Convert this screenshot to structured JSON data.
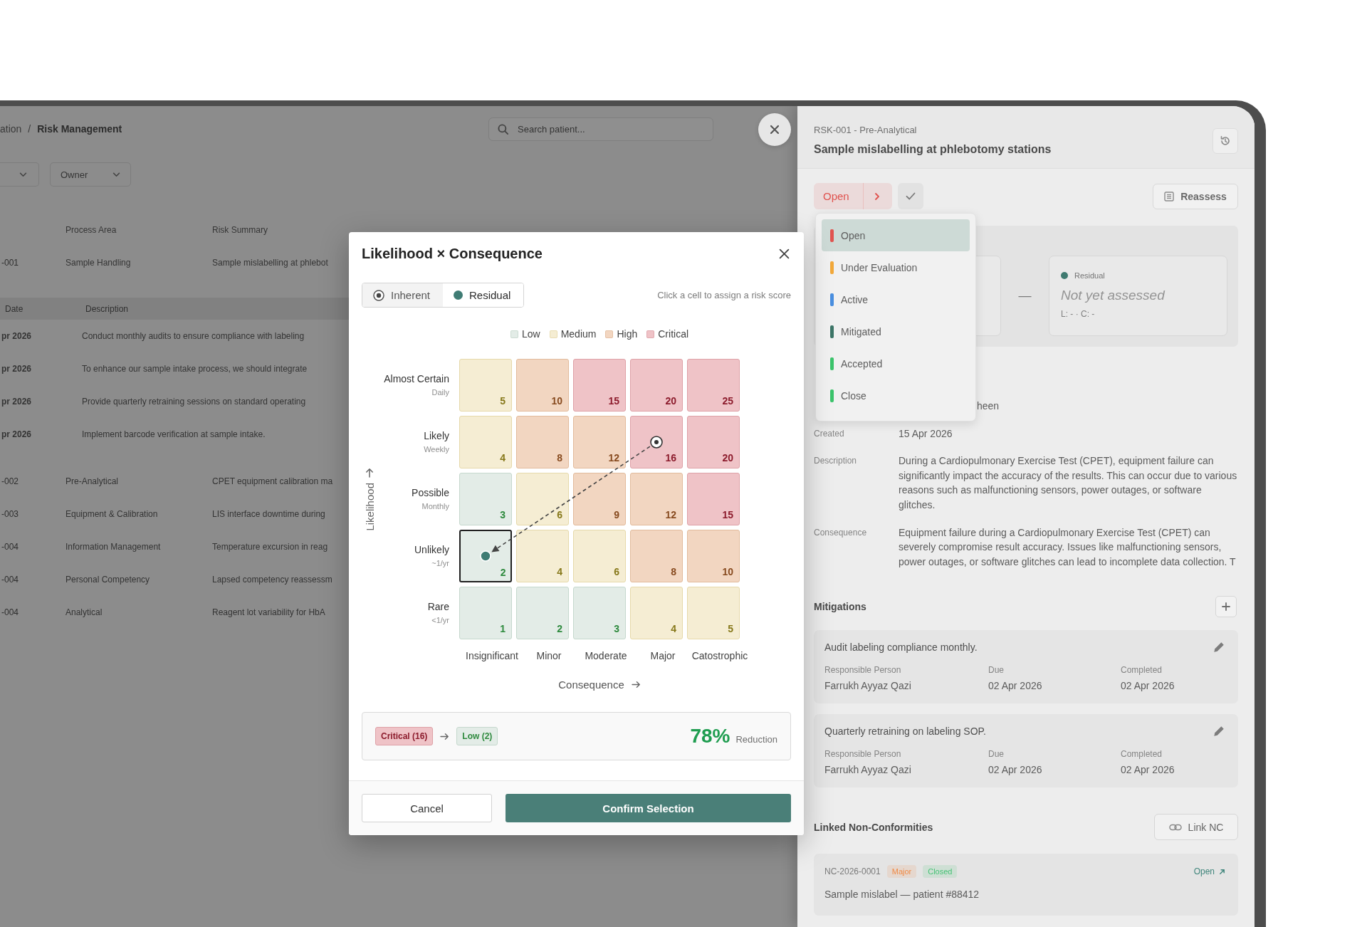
{
  "page": {
    "breadcrumb": {
      "parent": "ation",
      "separator": "/",
      "current": "Risk Management"
    },
    "search": {
      "placeholder": "Search patient..."
    },
    "filters": [
      {
        "kind": "dropdown"
      },
      {
        "kind": "dropdown",
        "label": "Owner"
      }
    ],
    "table": {
      "columns": [
        "Process Area",
        "Risk Summary"
      ],
      "rows": [
        {
          "id": "-001",
          "process_area": "Sample Handling",
          "summary": "Sample mislabelling at phlebot",
          "mitigations": {
            "columns": [
              "Date",
              "Description"
            ],
            "rows": [
              {
                "date": "pr 2026",
                "description": "Conduct monthly audits to ensure compliance with labeling"
              },
              {
                "date": "pr 2026",
                "description": "To enhance our sample intake process, we should integrate"
              },
              {
                "date": "pr 2026",
                "description": "Provide quarterly retraining sessions on standard operating"
              },
              {
                "date": "pr 2026",
                "description": "Implement barcode verification at sample intake."
              }
            ]
          }
        },
        {
          "id": "-002",
          "process_area": "Pre-Analytical",
          "summary": "CPET equipment calibration ma"
        },
        {
          "id": "-003",
          "process_area": "Equipment & Calibration",
          "summary": "LIS interface downtime during"
        },
        {
          "id": "-004",
          "process_area": "Information Management",
          "summary": "Temperature excursion in reag"
        },
        {
          "id": "-004",
          "process_area": "Personal Competency",
          "summary": "Lapsed competency reassessm"
        },
        {
          "id": "-004",
          "process_area": "Analytical",
          "summary": "Reagent lot variability for HbA"
        }
      ]
    }
  },
  "modal": {
    "title": "Likelihood × Consequence",
    "modes": [
      {
        "label": "Inherent",
        "kind": "inherent",
        "selected": false
      },
      {
        "label": "Residual",
        "kind": "residual",
        "selected": true
      }
    ],
    "hint": "Click a cell to assign a risk score",
    "legend": [
      {
        "label": "Low",
        "kind": "low"
      },
      {
        "label": "Medium",
        "kind": "medium"
      },
      {
        "label": "High",
        "kind": "high"
      },
      {
        "label": "Critical",
        "kind": "critical"
      }
    ],
    "y_axis": "Likelihood",
    "x_axis": "Consequence",
    "rows": [
      {
        "label": "Almost Certain",
        "sub": "Daily",
        "cells": [
          {
            "value": "5",
            "kind": "medium",
            "selected": false,
            "inherent": false,
            "residual": false
          },
          {
            "value": "10",
            "kind": "high",
            "selected": false,
            "inherent": false,
            "residual": false
          },
          {
            "value": "15",
            "kind": "critical",
            "selected": false,
            "inherent": false,
            "residual": false
          },
          {
            "value": "20",
            "kind": "critical",
            "selected": false,
            "inherent": false,
            "residual": false
          },
          {
            "value": "25",
            "kind": "critical",
            "selected": false,
            "inherent": false,
            "residual": false
          }
        ]
      },
      {
        "label": "Likely",
        "sub": "Weekly",
        "cells": [
          {
            "value": "4",
            "kind": "medium",
            "selected": false,
            "inherent": false,
            "residual": false
          },
          {
            "value": "8",
            "kind": "high",
            "selected": false,
            "inherent": false,
            "residual": false
          },
          {
            "value": "12",
            "kind": "high",
            "selected": false,
            "inherent": false,
            "residual": false
          },
          {
            "value": "16",
            "kind": "critical",
            "selected": false,
            "inherent": true,
            "residual": false
          },
          {
            "value": "20",
            "kind": "critical",
            "selected": false,
            "inherent": false,
            "residual": false
          }
        ]
      },
      {
        "label": "Possible",
        "sub": "Monthly",
        "cells": [
          {
            "value": "3",
            "kind": "low",
            "selected": false,
            "inherent": false,
            "residual": false
          },
          {
            "value": "6",
            "kind": "medium",
            "selected": false,
            "inherent": false,
            "residual": false
          },
          {
            "value": "9",
            "kind": "high",
            "selected": false,
            "inherent": false,
            "residual": false
          },
          {
            "value": "12",
            "kind": "high",
            "selected": false,
            "inherent": false,
            "residual": false
          },
          {
            "value": "15",
            "kind": "critical",
            "selected": false,
            "inherent": false,
            "residual": false
          }
        ]
      },
      {
        "label": "Unlikely",
        "sub": "~1/yr",
        "cells": [
          {
            "value": "2",
            "kind": "low",
            "selected": true,
            "inherent": false,
            "residual": true
          },
          {
            "value": "4",
            "kind": "medium",
            "selected": false,
            "inherent": false,
            "residual": false
          },
          {
            "value": "6",
            "kind": "medium",
            "selected": false,
            "inherent": false,
            "residual": false
          },
          {
            "value": "8",
            "kind": "high",
            "selected": false,
            "inherent": false,
            "residual": false
          },
          {
            "value": "10",
            "kind": "high",
            "selected": false,
            "inherent": false,
            "residual": false
          }
        ]
      },
      {
        "label": "Rare",
        "sub": "<1/yr",
        "cells": [
          {
            "value": "1",
            "kind": "low",
            "selected": false,
            "inherent": false,
            "residual": false
          },
          {
            "value": "2",
            "kind": "low",
            "selected": false,
            "inherent": false,
            "residual": false
          },
          {
            "value": "3",
            "kind": "low",
            "selected": false,
            "inherent": false,
            "residual": false
          },
          {
            "value": "4",
            "kind": "medium",
            "selected": false,
            "inherent": false,
            "residual": false
          },
          {
            "value": "5",
            "kind": "medium",
            "selected": false,
            "inherent": false,
            "residual": false
          }
        ]
      }
    ],
    "x_labels": [
      "Insignificant",
      "Minor",
      "Moderate",
      "Major",
      "Catostrophic"
    ],
    "summary": {
      "from": {
        "label": "Critical (16)",
        "kind": "critical"
      },
      "to": {
        "label": "Low (2)",
        "kind": "low"
      },
      "reduction": "78%",
      "reduction_label": "Reduction"
    },
    "buttons": {
      "cancel": "Cancel",
      "confirm": "Confirm Selection"
    }
  },
  "drawer": {
    "code": "RSK-001 - Pre-Analytical",
    "title": "Sample mislabelling at phlebotomy stations",
    "status": {
      "label": "Open"
    },
    "reassess": "Reassess",
    "status_menu": [
      {
        "label": "Open",
        "color": "#e0534f",
        "selected": true
      },
      {
        "label": "Under Evaluation",
        "color": "#f2a93b",
        "selected": false
      },
      {
        "label": "Active",
        "color": "#4a8fe0",
        "selected": false
      },
      {
        "label": "Mitigated",
        "color": "#3d7668",
        "selected": false
      },
      {
        "label": "Accepted",
        "color": "#3cc46c",
        "selected": false
      },
      {
        "label": "Close",
        "color": "#3cc46c",
        "selected": false
      }
    ],
    "scores": {
      "separator": "—",
      "residual": {
        "label": "Residual",
        "value": "Not yet assessed",
        "detail": "L: - · C: -"
      }
    },
    "fields": [
      {
        "value": "heen"
      },
      {
        "label": "Created",
        "value": "15 Apr 2026"
      },
      {
        "label": "Description",
        "value": "During a Cardiopulmonary Exercise Test (CPET), equipment failure can significantly impact the accuracy of the results. This can occur due to various reasons such as malfunctioning sensors, power outages, or software glitches."
      },
      {
        "label": "Consequence",
        "value": "Equipment failure during a Cardiopulmonary Exercise Test (CPET) can severely compromise result accuracy. Issues like malfunctioning sensors, power outages, or software glitches can lead to incomplete data collection. T"
      }
    ],
    "mitigations": {
      "title": "Mitigations",
      "items": [
        {
          "title": "Audit labeling compliance monthly.",
          "fields": [
            {
              "label": "Responsible Person",
              "value": "Farrukh Ayyaz Qazi"
            },
            {
              "label": "Due",
              "value": "02 Apr 2026"
            },
            {
              "label": "Completed",
              "value": "02 Apr 2026"
            }
          ]
        },
        {
          "title": "Quarterly retraining on labeling SOP.",
          "fields": [
            {
              "label": "Responsible Person",
              "value": "Farrukh Ayyaz Qazi"
            },
            {
              "label": "Due",
              "value": "02 Apr 2026"
            },
            {
              "label": "Completed",
              "value": "02 Apr 2026"
            }
          ]
        }
      ]
    },
    "linked": {
      "title": "Linked Non-Conformities",
      "button": "Link NC",
      "items": [
        {
          "id": "NC-2026-0001",
          "tags": [
            {
              "label": "Major",
              "color": "#f08a45"
            },
            {
              "label": "Closed",
              "color": "#45c274"
            }
          ],
          "link": "Open",
          "summary": "Sample mislabel — patient #88412"
        }
      ]
    }
  }
}
